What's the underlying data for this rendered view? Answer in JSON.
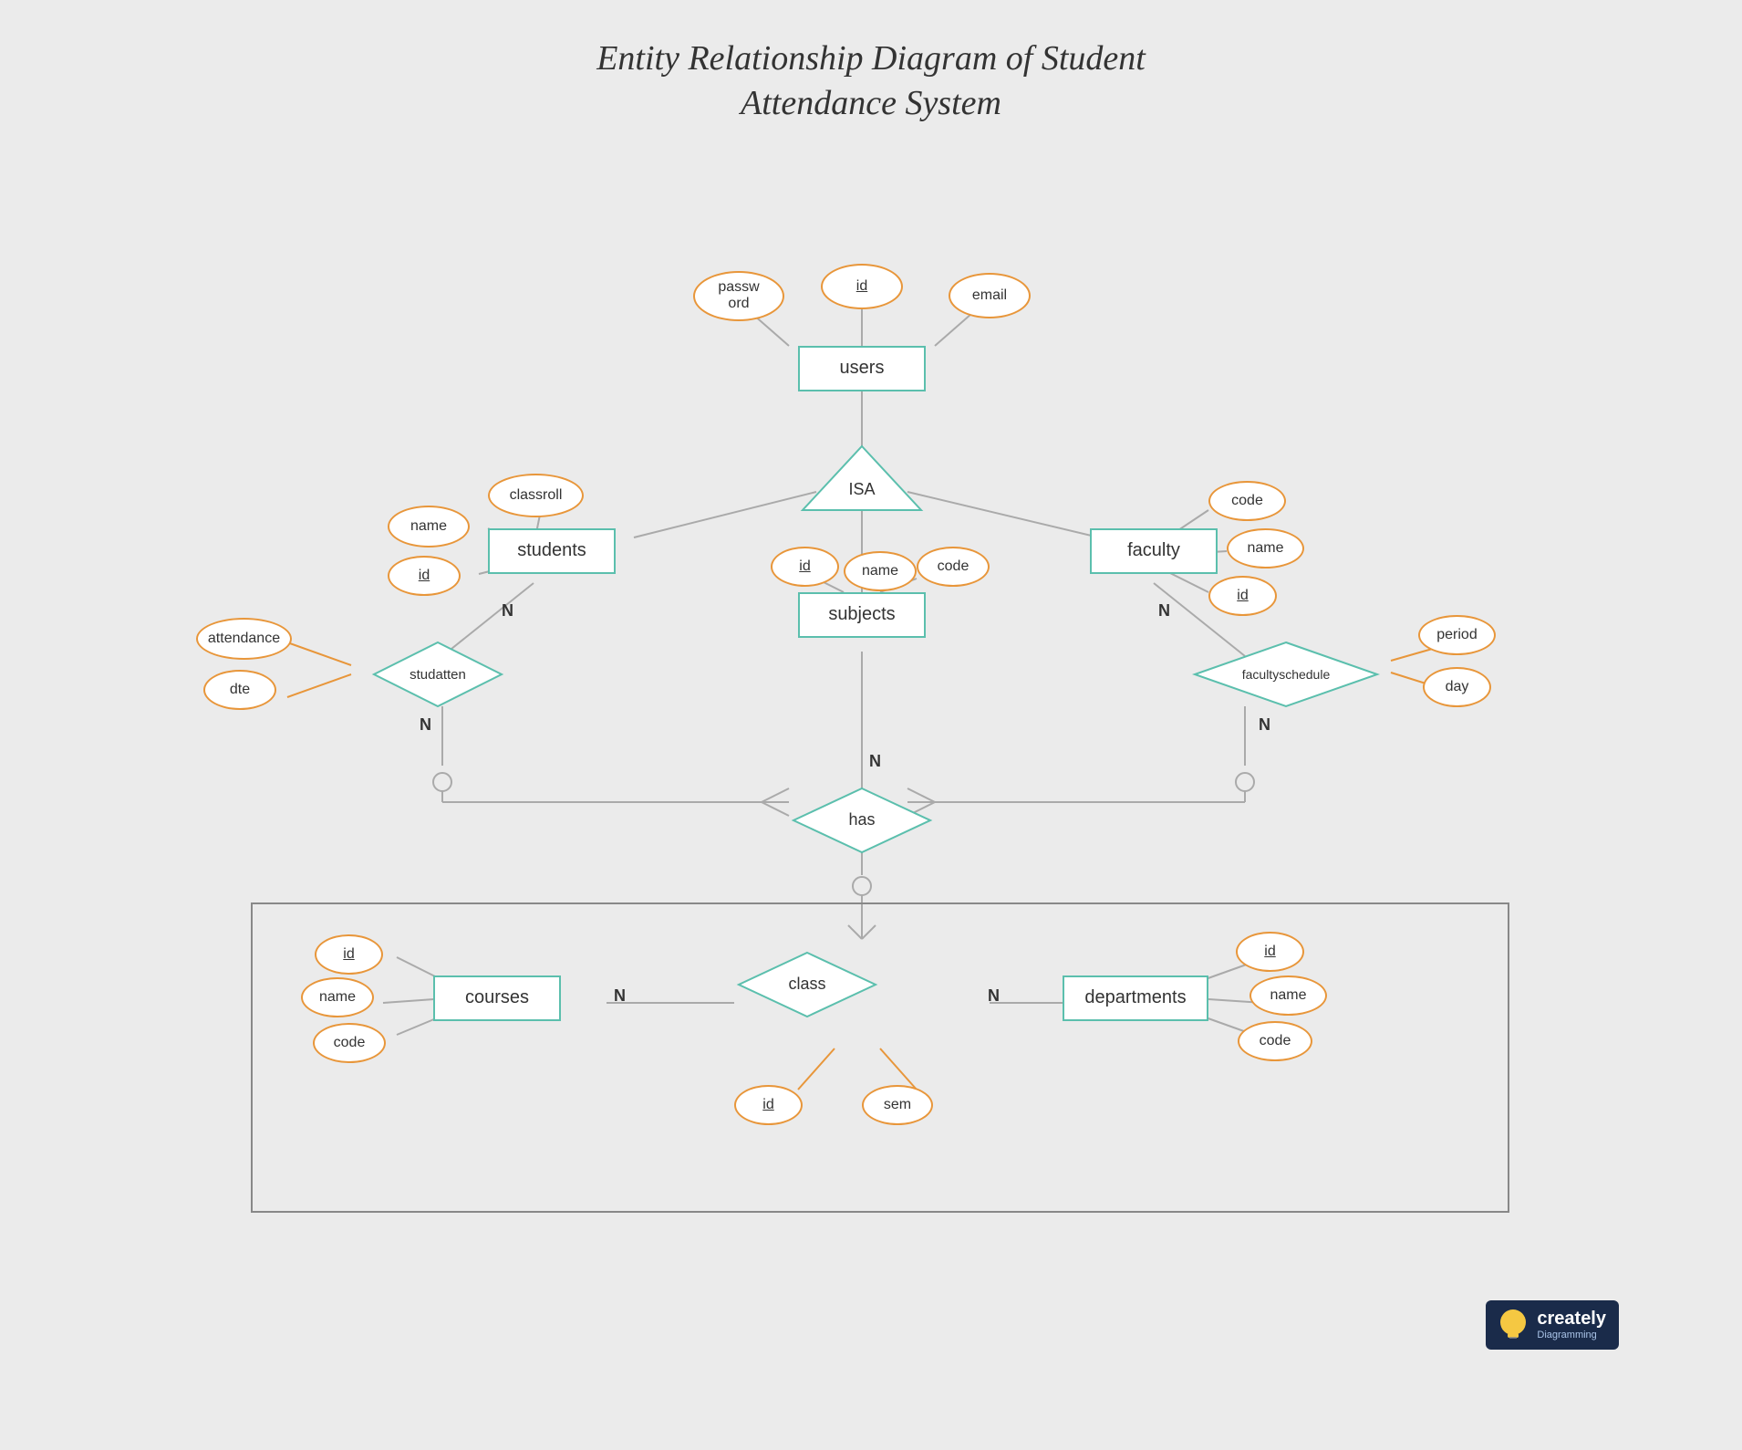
{
  "title": {
    "line1": "Entity Relationship Diagram of Student",
    "line2": "Attendance System"
  },
  "entities": {
    "users": "users",
    "students": "students",
    "faculty": "faculty",
    "subjects": "subjects",
    "courses": "courses",
    "departments": "departments",
    "class": "class"
  },
  "relationships": {
    "isa": "ISA",
    "studatten": "studatten",
    "facultyschedule": "facultyschedule",
    "has": "has"
  },
  "attributes": {
    "users_id": "id",
    "users_password": "password",
    "users_email": "email",
    "students_name": "name",
    "students_id": "id",
    "students_classroll": "classroll",
    "faculty_code": "code",
    "faculty_name": "name",
    "faculty_id": "id",
    "subjects_id": "id",
    "subjects_name": "name",
    "subjects_code": "code",
    "studatten_attendance": "attendance",
    "studatten_dte": "dte",
    "facultyschedule_period": "period",
    "facultyschedule_day": "day",
    "courses_id": "id",
    "courses_name": "name",
    "courses_code": "code",
    "departments_id": "id",
    "departments_name": "name",
    "departments_code": "code",
    "class_id": "id",
    "class_sem": "sem"
  },
  "cardinality": {
    "studatten_students": "N",
    "studatten_facultyschedule": "N",
    "has_subjects": "N",
    "courses_class": "N",
    "departments_class": "N"
  },
  "logo": {
    "brand": "creately",
    "sub": "Diagramming"
  }
}
